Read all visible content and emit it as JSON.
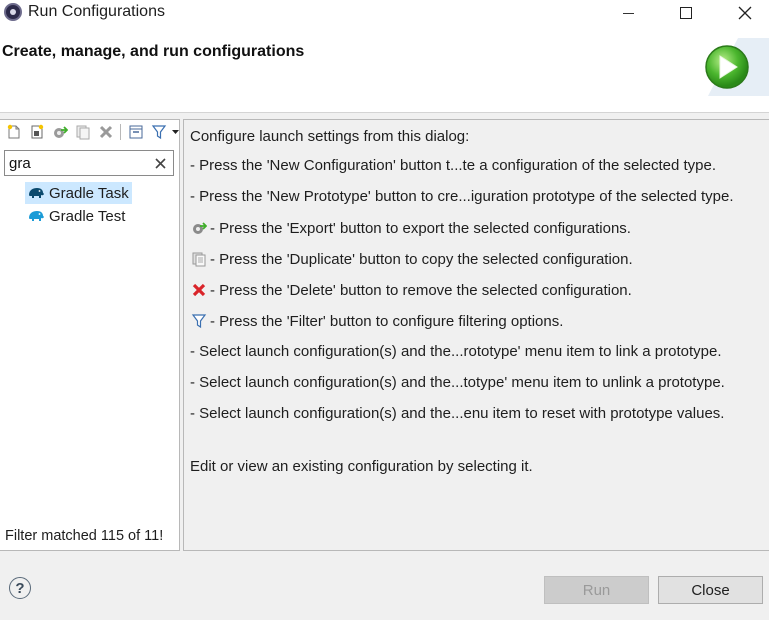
{
  "window": {
    "title": "Run Configurations"
  },
  "header": {
    "title": "Create, manage, and run configurations"
  },
  "toolbar": {
    "icons": [
      "new-configuration-icon",
      "new-prototype-icon",
      "export-icon",
      "duplicate-icon",
      "delete-icon",
      "collapse-all-icon",
      "filter-icon",
      "view-menu-icon"
    ]
  },
  "search": {
    "value": "gra"
  },
  "tree": {
    "items": [
      {
        "label": "Gradle Task",
        "icon": "gradle-elephant-icon",
        "selected": true
      },
      {
        "label": "Gradle Test",
        "icon": "gradle-elephant-icon",
        "selected": false
      }
    ]
  },
  "filter_status": "Filter matched 115 of 11!",
  "help": {
    "intro": "Configure launch settings from this dialog:",
    "lines": [
      "- Press the 'New Configuration' button t...te a configuration of the selected type.",
      "- Press the 'New Prototype' button to cre...iguration prototype of the selected type.",
      "- Press the 'Export' button to export the selected configurations.",
      "- Press the 'Duplicate' button to copy the selected configuration.",
      "- Press the 'Delete' button to remove the selected configuration.",
      "- Press the 'Filter' button to configure filtering options.",
      "- Select launch configuration(s) and the...rototype' menu item to link a prototype.",
      "- Select launch configuration(s) and the...totype' menu item to unlink a prototype.",
      "- Select launch configuration(s) and the...enu item to reset with prototype values."
    ],
    "footer": "Edit or view an existing configuration by selecting it."
  },
  "buttons": {
    "run": "Run",
    "close": "Close",
    "help": "?"
  },
  "colors": {
    "selection": "#cce8ff",
    "run_green": "#3fae2a",
    "delete_red": "#d9242a",
    "gradle_blue": "#1b9bd7",
    "gradle_dark": "#0b4a6e"
  }
}
